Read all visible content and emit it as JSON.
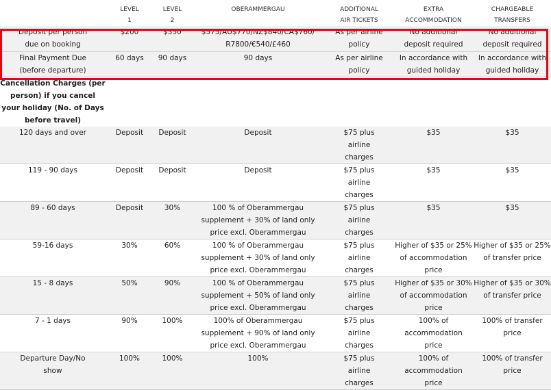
{
  "headers": [
    "",
    "LEVEL 1",
    "LEVEL 2",
    "OBERAMMERGAU",
    "ADDITIONAL AIR TICKETS",
    "EXTRA ACCOMMODATION",
    "CHARGEABLE TRANSFERS"
  ],
  "header_parts": [
    [
      "",
      ""
    ],
    [
      "LEVEL",
      "1"
    ],
    [
      "LEVEL",
      "2"
    ],
    [
      "OBERAMMERGAU",
      ""
    ],
    [
      "ADDITIONAL",
      "AIR TICKETS"
    ],
    [
      "EXTRA",
      "ACCOMMODATION"
    ],
    [
      "CHARGEABLE",
      "TRANSFERS"
    ]
  ],
  "deposit_row": [
    "Deposit per person due on booking",
    "$200",
    "$350",
    "$575/AU$770/NZ$840/CA$760/ R7800/€540/£460",
    "As per airline policy",
    "No additional deposit required",
    "No additional deposit required"
  ],
  "final_row": [
    "Final Payment Due (before departure)",
    "60 days",
    "90 days",
    "90 days",
    "As per airline policy",
    "In accordance with guided holiday",
    "In accordance with guided holiday"
  ],
  "cancel_title": "Cancellation Charges (per person) if you cancel your holiday (No. of Days before travel)",
  "cancel_rows": [
    [
      "120 days and over",
      "Deposit",
      "Deposit",
      "Deposit",
      "$75 plus airline charges",
      "$35",
      "$35"
    ],
    [
      "119 - 90 days",
      "Deposit",
      "Deposit",
      "Deposit",
      "$75 plus airline charges",
      "$35",
      "$35"
    ],
    [
      "89 - 60 days",
      "Deposit",
      "30%",
      "100 % of Oberammergau supplement + 30% of land only price excl. Oberammergau",
      "$75 plus airline charges",
      "$35",
      "$35"
    ],
    [
      "59-16 days",
      "30%",
      "60%",
      "100 % of Oberammergau supplement + 30% of land only price excl. Oberammergau",
      "$75 plus airline charges",
      "Higher of $35 or 25% of accommodation price",
      "Higher of $35 or 25% of transfer price"
    ],
    [
      "15 - 8 days",
      "50%",
      "90%",
      "100 % of Oberammergau supplement + 50% of land only price excl. Oberammergau",
      "$75 plus airline charges",
      "Higher of $35 or 30% of accommodation price",
      "Higher of $35 or 30% of transfer price"
    ],
    [
      "7 - 1 days",
      "90%",
      "100%",
      "100% of Oberammergau supplement + 90% of land only price excl. Oberammergau",
      "$75 plus airline charges",
      "100% of accommodation price",
      "100% of transfer price"
    ],
    [
      "Departure Day/No show",
      "100%",
      "100%",
      "100%",
      "$75 plus airline charges",
      "100% of accommodation price",
      "100% of transfer price"
    ]
  ],
  "highlight_color": "#e30613"
}
